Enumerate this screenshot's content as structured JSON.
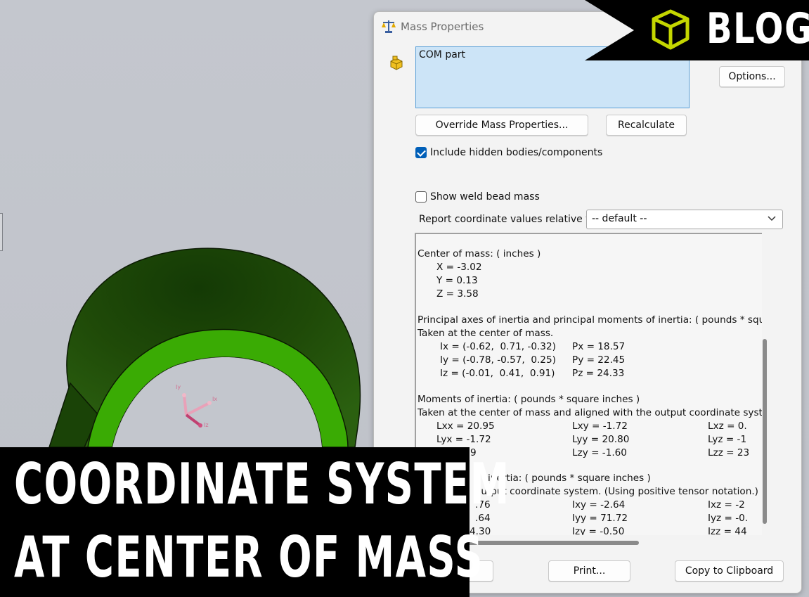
{
  "dialog": {
    "title": "Mass Properties",
    "selection_items": [
      "COM part"
    ],
    "options_button": "Options...",
    "override_button": "Override Mass Properties...",
    "recalculate_button": "Recalculate",
    "include_hidden": {
      "label": "Include hidden bodies/components",
      "checked": true
    },
    "weld_bead": {
      "label": "Show weld bead mass",
      "checked": false
    },
    "report_label": "Report coordinate values relative to:",
    "coord_select": {
      "value": "-- default --"
    },
    "results": {
      "com_header": "Center of mass: ( inches )",
      "com_x": "X = -3.02",
      "com_y": "Y = 0.13",
      "com_z": "Z = 3.58",
      "principal_header": "Principal axes of inertia and principal moments of inertia: ( pounds * squ",
      "principal_sub": "Taken at the center of mass.",
      "ix": "Ix = (-0.62,  0.71, -0.32)",
      "px": "Px = 18.57",
      "iy": "Iy = (-0.78, -0.57,  0.25)",
      "py": "Py = 22.45",
      "iz": "Iz = (-0.01,  0.41,  0.91)",
      "pz": "Pz = 24.33",
      "moments_header": "Moments of inertia: ( pounds * square inches )",
      "moments_sub": "Taken at the center of mass and aligned with the output coordinate syste",
      "lxx": "Lxx = 20.95",
      "lxy": "Lxy = -1.72",
      "lxz": "Lxz = 0.",
      "lyx": "Lyx = -1.72",
      "lyy": "Lyy = 20.80",
      "lyz": "Lyz = -1",
      "lzx": ".79",
      "lzy": "Lzy = -1.60",
      "lzz": "Lzz = 23",
      "moments2_header": "inertia: ( pounds * square inches )",
      "moments2_sub": "output coordinate system. (Using positive tensor notation.)",
      "ixx": ".76",
      "ixy": "Ixy = -2.64",
      "ixz": "Ixz = -2",
      "iyx": ".64",
      "iyy": "Iyy = 71.72",
      "iyz": "Iyz = -0.",
      "izx": "4.30",
      "izy": "Izy = -0.50",
      "izz": "Izz = 44"
    },
    "print_button": "Print...",
    "copy_button": "Copy to Clipboard"
  },
  "banner": {
    "label": "BLOG"
  },
  "caption": {
    "line1": "COORDINATE SYSTEM",
    "line2": "AT CENTER OF MASS"
  },
  "colors": {
    "part_dark": "#1f4a08",
    "part_bright": "#3aab04",
    "selection": "#cce4f7",
    "checkbox": "#005fb8",
    "banner_icon": "#c4d600"
  }
}
